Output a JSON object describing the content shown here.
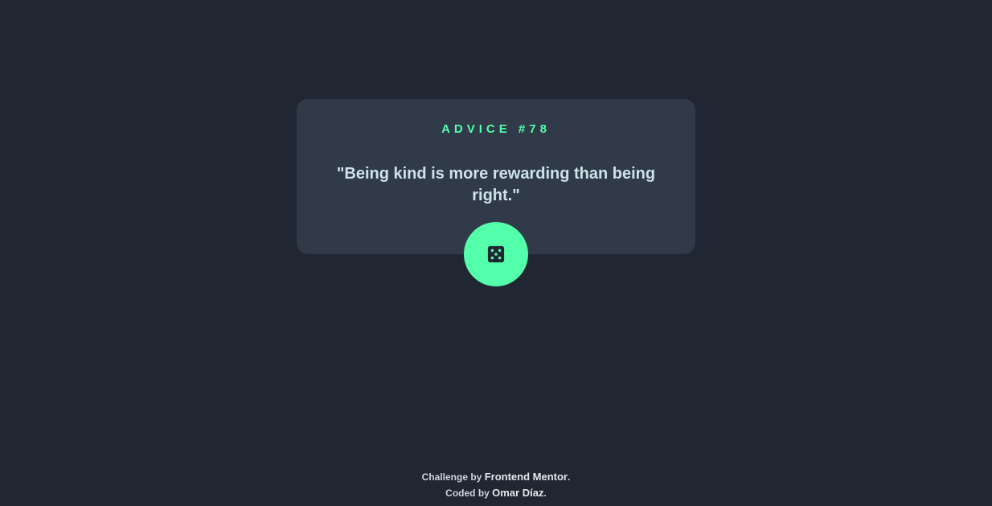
{
  "card": {
    "advice_label": "ADVICE #78",
    "quote": "\"Being kind is more rewarding than being right.\""
  },
  "dice_button": {
    "icon": "dice-icon",
    "accent": "#53ffaa"
  },
  "footer": {
    "challenge_prefix": "Challenge by",
    "challenge_link": "Frontend Mentor",
    "coded_prefix": "Coded by",
    "coded_link": "Omar Díaz",
    "period": "."
  },
  "colors": {
    "background": "#202632",
    "card": "#313a49",
    "accent": "#53ffaa",
    "quote_text": "#cee3e9"
  }
}
